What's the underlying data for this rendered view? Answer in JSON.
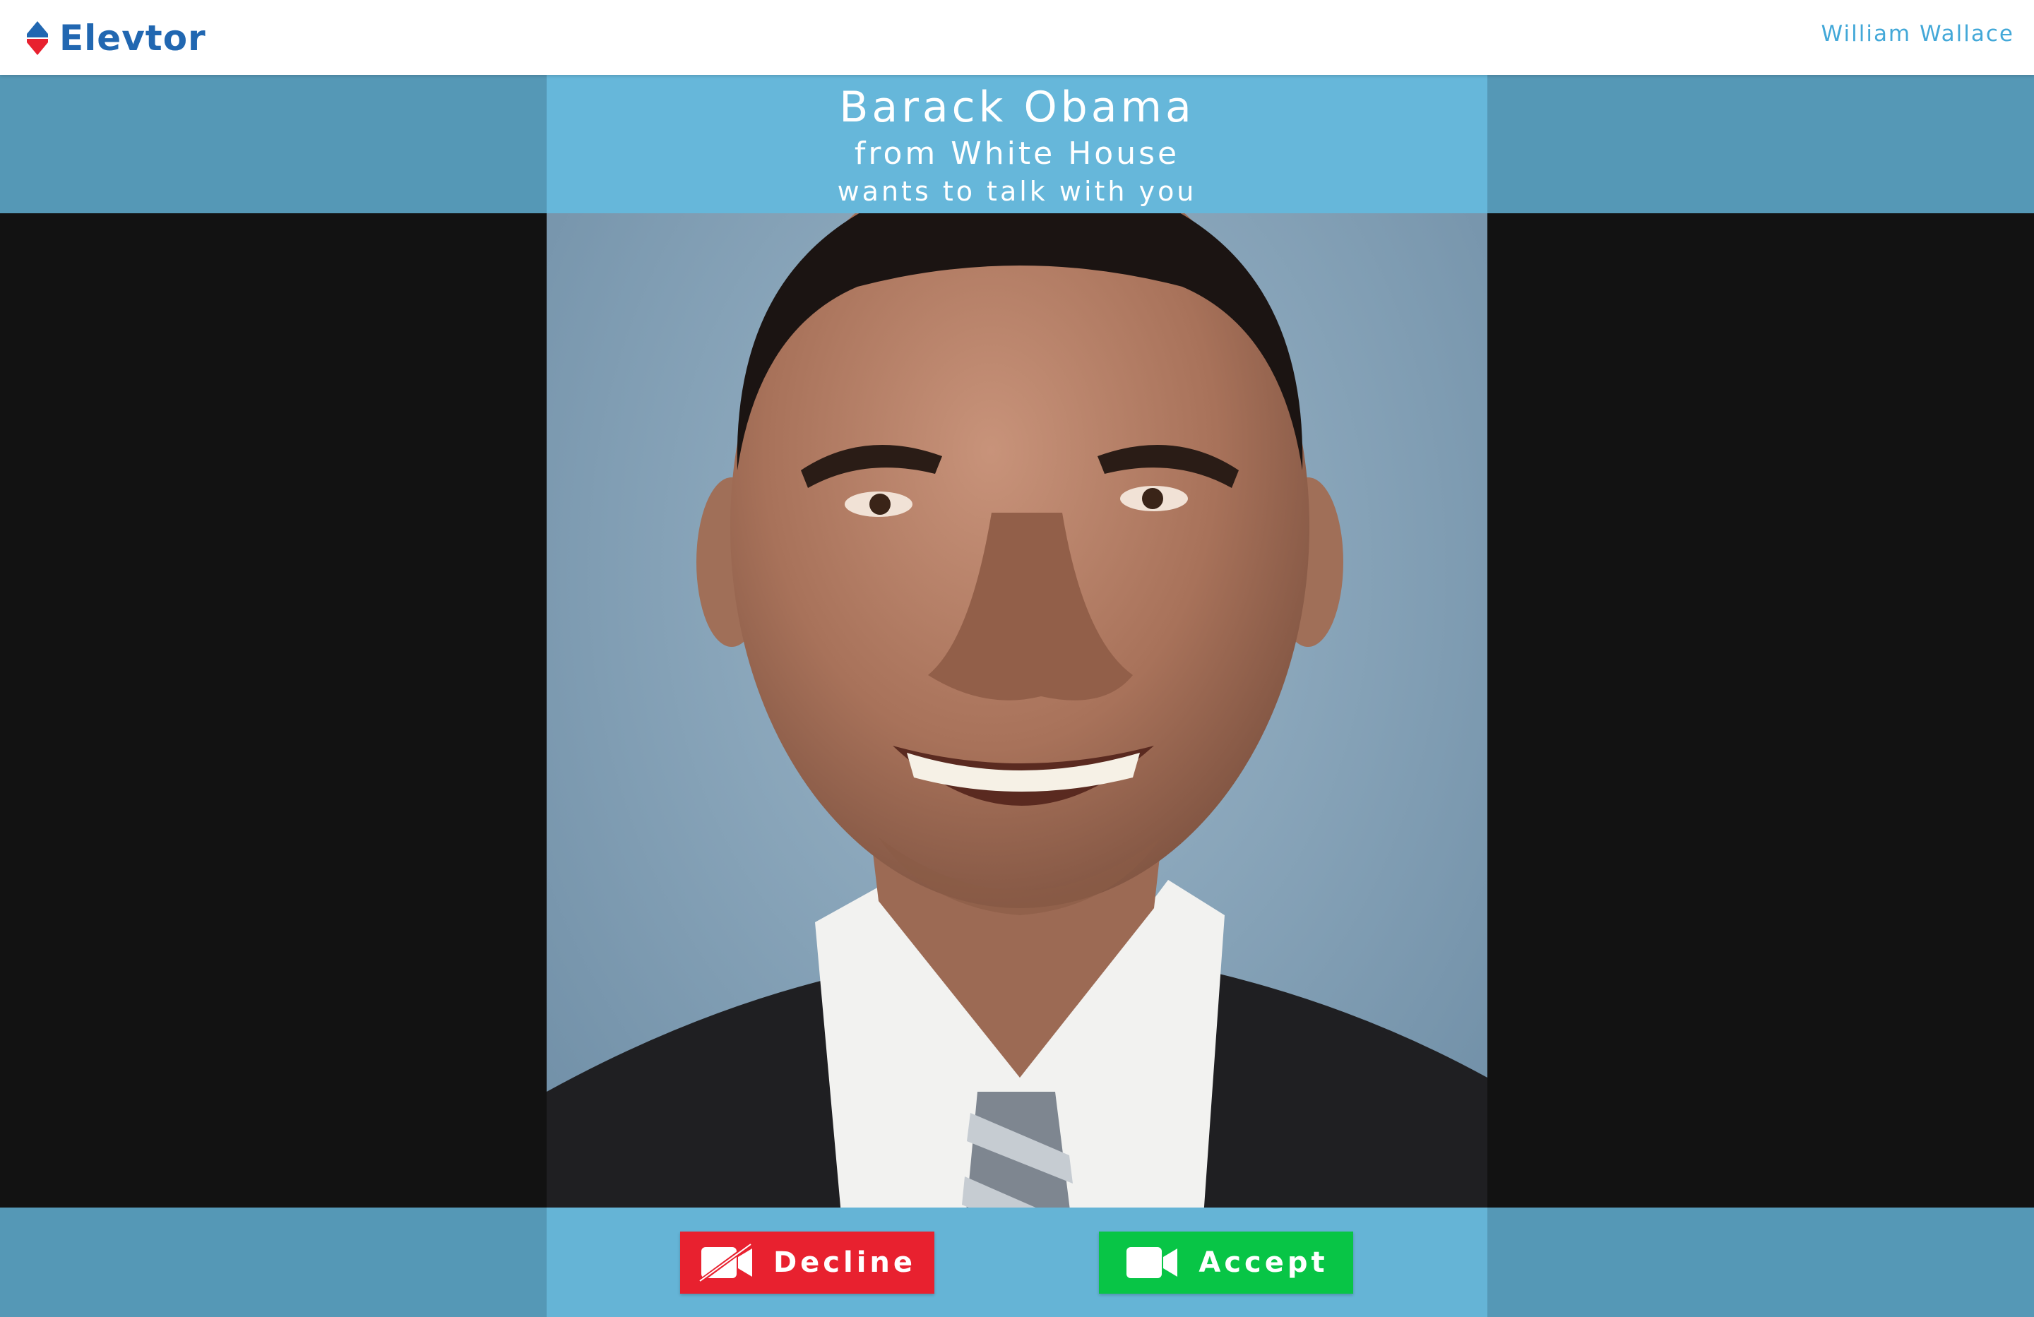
{
  "app": {
    "brand_name": "Elevtor",
    "user_name": "William Wallace",
    "colors": {
      "brand_blue": "#2167b1",
      "user_text": "#43a8d8",
      "band": "#5598b6",
      "band_center": "#6cc0e4",
      "decline": "#e8212f",
      "accept": "#08c546"
    }
  },
  "call": {
    "caller_name": "Barack Obama",
    "caller_org": "from White House",
    "message": "wants to talk with you"
  },
  "actions": {
    "decline_label": "Decline",
    "decline_icon": "video-off-icon",
    "accept_label": "Accept",
    "accept_icon": "video-camera-icon"
  }
}
